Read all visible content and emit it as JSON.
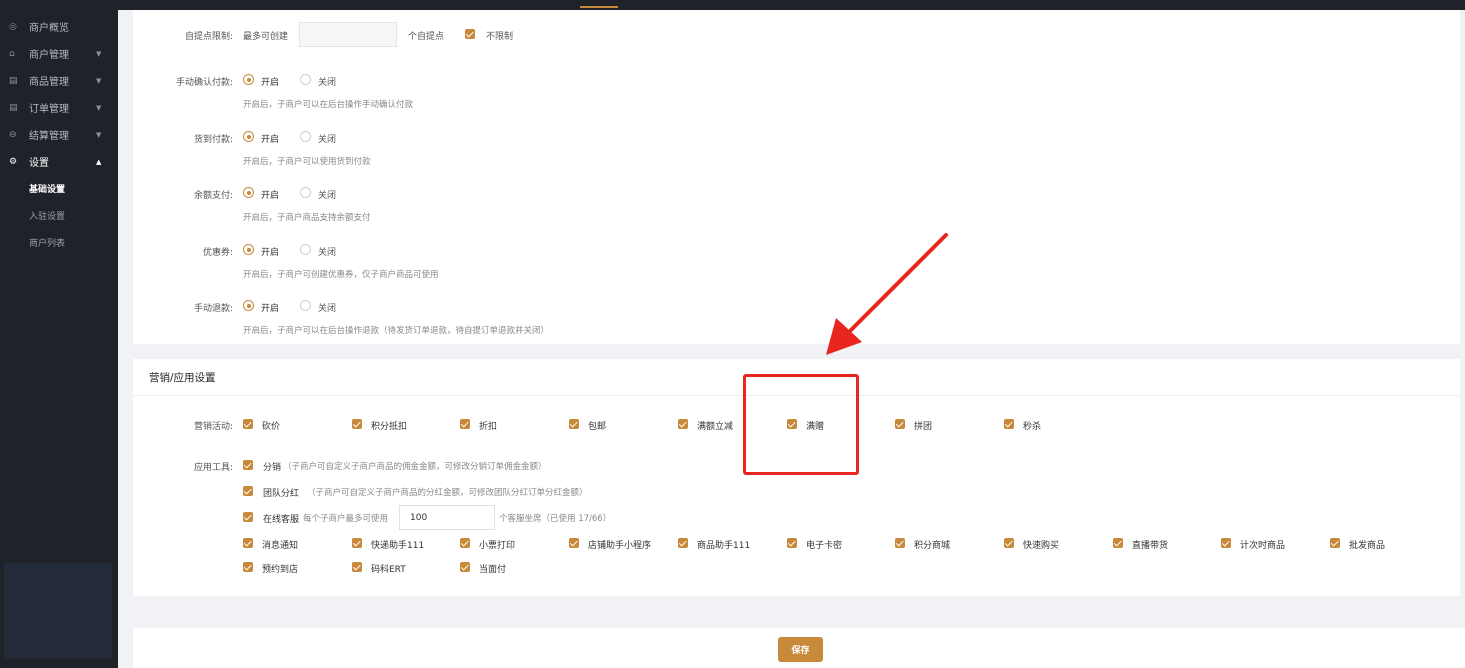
{
  "sidebar": {
    "items": [
      {
        "label": "商户概览",
        "icon": "overview-icon",
        "glyph": "◎",
        "caret": ""
      },
      {
        "label": "商户管理",
        "icon": "shop-icon",
        "glyph": "⌂",
        "caret": "▼"
      },
      {
        "label": "商品管理",
        "icon": "goods-icon",
        "glyph": "▤",
        "caret": "▼"
      },
      {
        "label": "订单管理",
        "icon": "order-icon",
        "glyph": "▤",
        "caret": "▼"
      },
      {
        "label": "结算管理",
        "icon": "settlement-icon",
        "glyph": "⊖",
        "caret": "▼"
      }
    ],
    "settings": {
      "label": "设置",
      "icon": "gear-icon",
      "glyph": "⚙",
      "caret": "▲"
    },
    "sub_items": [
      "基础设置",
      "入驻设置",
      "商户列表"
    ]
  },
  "pickup": {
    "label": "自提点限制:",
    "prefix": "最多可创建",
    "suffix": "个自提点",
    "unlimited_label": "不限制"
  },
  "radio_rows": [
    {
      "label": "手动确认付款:",
      "on": "开启",
      "off": "关闭",
      "hint": "开启后，子商户可以在后台操作手动确认付款"
    },
    {
      "label": "货到付款:",
      "on": "开启",
      "off": "关闭",
      "hint": "开启后，子商户可以使用货到付款"
    },
    {
      "label": "余额支付:",
      "on": "开启",
      "off": "关闭",
      "hint": "开启后，子商户商品支持余额支付"
    },
    {
      "label": "优惠券:",
      "on": "开启",
      "off": "关闭",
      "hint": "开启后，子商户可创建优惠券，仅子商户商品可使用"
    },
    {
      "label": "手动退款:",
      "on": "开启",
      "off": "关闭",
      "hint": "开启后，子商户可以在后台操作退款（待发货订单退款，待自提订单退款并关闭）"
    }
  ],
  "marketing": {
    "section_title": "营销/应用设置",
    "activities_label": "营销活动:",
    "activities": [
      "砍价",
      "积分抵扣",
      "折扣",
      "包邮",
      "满额立减",
      "满赠",
      "拼团",
      "秒杀"
    ],
    "tools_label": "应用工具:",
    "distribution_label": "分销",
    "distribution_hint": "（子商户可自定义子商户商品的佣金金额，可修改分销订单佣金金额）",
    "team_label": "团队分红",
    "team_hint": "（子商户可自定义子商户商品的分红金额，可修改团队分红订单分红金额）",
    "service_label": "在线客服",
    "service_prefix": "每个子商户最多可使用",
    "service_value": "100",
    "service_suffix": "个客服坐席（已使用 17/66）",
    "tools_row1": [
      "消息通知",
      "快递助手111",
      "小票打印",
      "店铺助手小程序",
      "商品助手111",
      "电子卡密",
      "积分商城",
      "快速购买",
      "直播带货",
      "计次时商品",
      "批发商品"
    ],
    "tools_row2": [
      "预约到店",
      "码科ERT",
      "当面付"
    ]
  },
  "footer": {
    "save_label": "保存"
  },
  "colors": {
    "accent": "#c8893a",
    "sidebar_bg": "#1f2228",
    "annotation": "#e8251f"
  }
}
